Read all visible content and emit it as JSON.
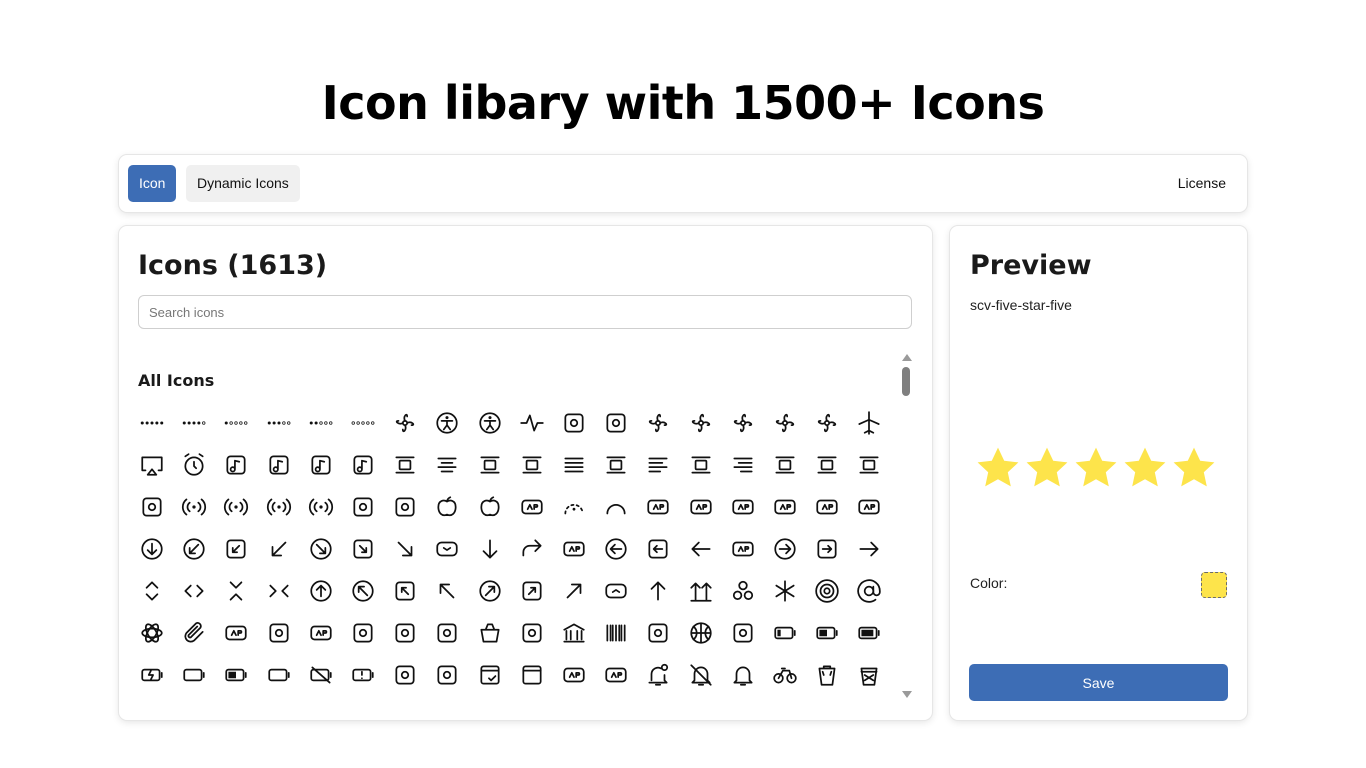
{
  "page": {
    "title": "Icon libary with 1500+ Icons"
  },
  "topbar": {
    "tabs": [
      {
        "label": "Icon",
        "active": true
      },
      {
        "label": "Dynamic Icons",
        "active": false
      }
    ],
    "license_label": "License"
  },
  "icons_panel": {
    "heading": "Icons (1613)",
    "search": {
      "placeholder": "Search icons",
      "value": ""
    },
    "section_label": "All Icons",
    "icons": [
      "five-star-five-icon",
      "five-star-four-icon",
      "five-star-one-icon",
      "five-star-three-icon",
      "five-star-two-icon",
      "five-star-zero-icon",
      "accessibility-wheelchair-icon",
      "accessibility-box-icon",
      "accessibility-person-icon",
      "activity-icon",
      "ad-product-icon",
      "add-loop-icon",
      "air-conditioning-icon",
      "air-drone-icon",
      "air-fan-icon",
      "airplane-window-icon",
      "airplay-icon",
      "airplane-icon",
      "airplay-display-icon",
      "alarm-clock-icon",
      "album-music-icon",
      "album-open-icon",
      "albums-icon",
      "music-note-box-icon",
      "align-top-icon",
      "align-center-icon",
      "align-horizontal-center-icon",
      "align-horizontal-split-icon",
      "align-justify-icon",
      "align-right-dashed-icon",
      "align-left-text-icon",
      "align-vertical-dashed-icon",
      "align-right-text-icon",
      "align-bottom-dashed-icon",
      "align-vertical-center-icon",
      "align-top-box-icon",
      "l-shape-icon",
      "antenna-off-icon",
      "antenna-box-icon",
      "antenna-waves-icon",
      "radio-tower-icon",
      "app-notification-icon",
      "application-window-icon",
      "apple-half-icon",
      "apple-icon",
      "ar-badge-icon",
      "arc-dashed-icon",
      "arc-icon",
      "arcade-joystick-icon",
      "arrows-cross-icon",
      "arrow-target-icon",
      "archive-document-icon",
      "area-select-icon",
      "arrow-diagonal-icon",
      "arrow-circle-down-icon",
      "arrow-circle-down-left-icon",
      "arrow-box-down-left-icon",
      "arrow-down-left-icon",
      "arrow-circle-down-right-icon",
      "arrow-box-down-right-icon",
      "arrow-down-right-icon",
      "chevron-box-down-icon",
      "arrow-down-icon",
      "redo-arrow-icon",
      "code-box-icon",
      "arrow-circle-left-icon",
      "arrow-box-left-icon",
      "arrow-left-icon",
      "collapse-box-icon",
      "arrow-circle-right-icon",
      "arrow-box-right-icon",
      "arrow-right-icon",
      "chevron-up-down-icon",
      "chevrons-left-right-icon",
      "chevrons-collapse-icon",
      "chevrons-inward-icon",
      "arrow-circle-up-icon",
      "arrow-circle-up-left-icon",
      "arrow-box-up-left-icon",
      "arrow-up-left-icon",
      "arrow-circle-up-right-icon",
      "arrow-box-up-right-icon",
      "arrow-up-right-icon",
      "chevron-box-up-icon",
      "arrow-up-icon",
      "double-arrow-up-icon",
      "cluster-circles-icon",
      "asterisk-icon",
      "at-sign-circle-icon",
      "at-sign-icon",
      "atom-icon",
      "attachment-icon",
      "augmented-reality-icon",
      "auto-flash-icon",
      "avi-file-icon",
      "axis-3d-icon",
      "back-15-icon",
      "badge-check-icon",
      "bag-icon",
      "balcony-icon",
      "bank-icon",
      "barcode-icon",
      "baseball-field-icon",
      "basketball-icon",
      "bathtub-icon",
      "battery-low-icon",
      "battery-half-icon",
      "battery-full-icon",
      "battery-charging-icon",
      "battery-empty-icon",
      "battery-medium-icon",
      "car-battery-icon",
      "battery-slash-icon",
      "battery-warning-icon",
      "bbq-grill-icon",
      "shopping-basket-icon",
      "bed-check-icon",
      "bed-icon",
      "behance-box-icon",
      "behance-icon",
      "bell-badge-icon",
      "bell-off-icon",
      "bell-icon",
      "bicycle-icon",
      "bin-icon",
      "bin-full-icon"
    ]
  },
  "preview": {
    "heading": "Preview",
    "icon_name": "scv-five-star-five",
    "star_count": 5,
    "color_label": "Color:",
    "color": "#fde44b",
    "save_label": "Save"
  },
  "theme": {
    "accent": "#3d6db5",
    "star_fill": "#fde44b"
  }
}
